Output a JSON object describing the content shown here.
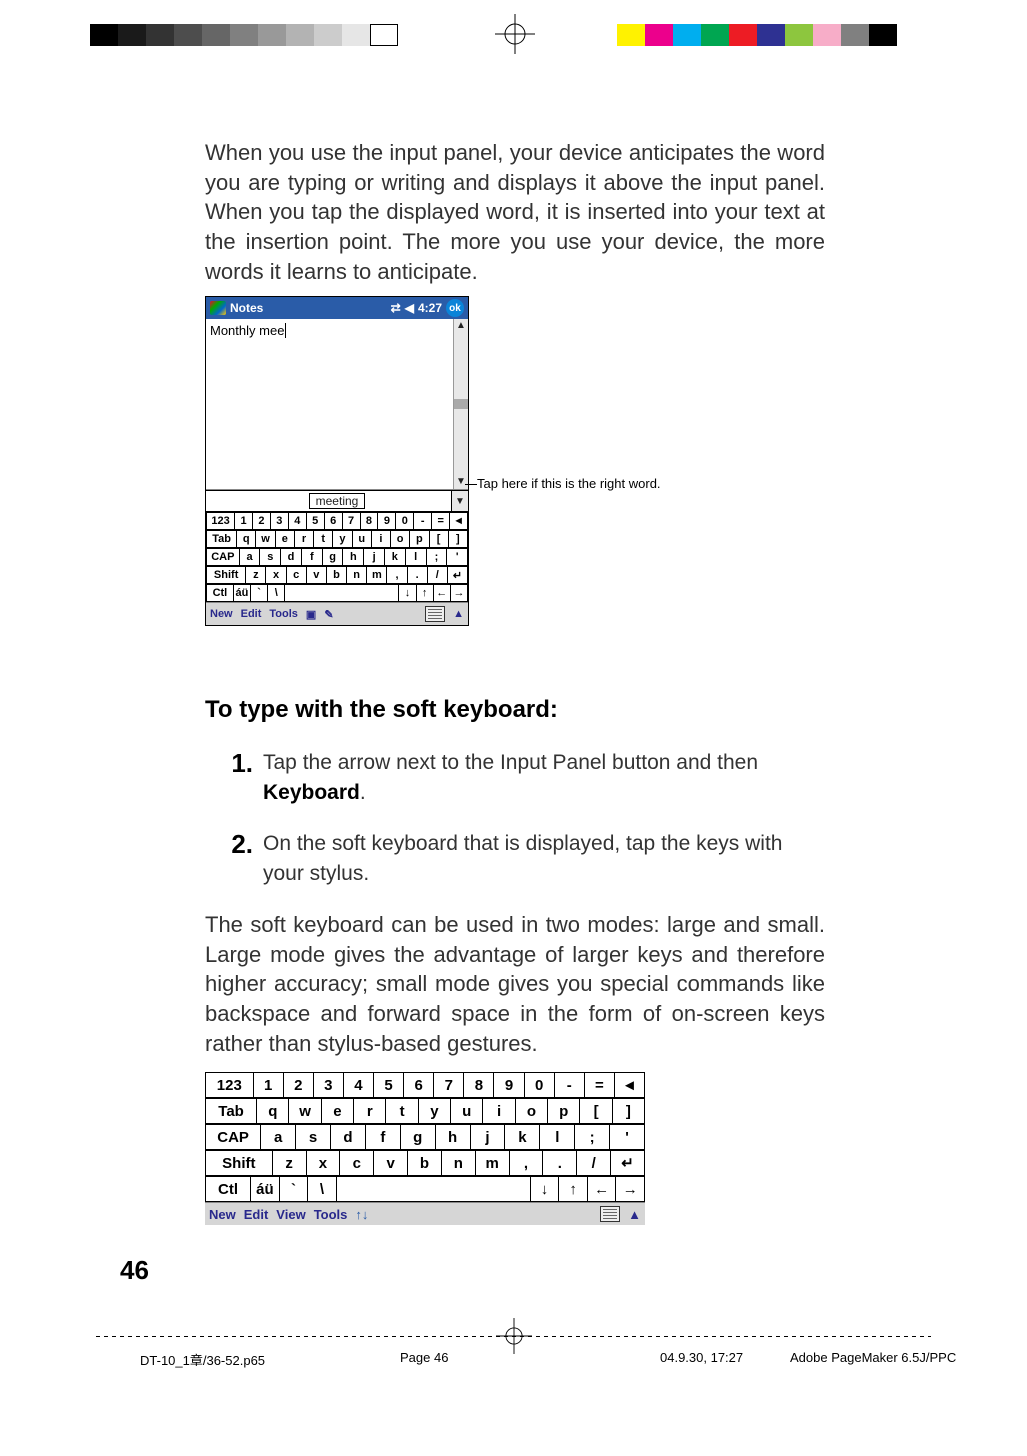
{
  "intro_para": "When you use the input panel, your device anticipates the word you are typing or writing and displays it above the input panel. When you tap the displayed word, it is inserted into your text at the insertion point. The more you use your device, the more words it learns to anticipate.",
  "pda": {
    "app_title": "Notes",
    "time": "4:27",
    "ok": "ok",
    "typed_text": "Monthly mee",
    "suggestion": "meeting",
    "callout": "Tap here if this is the right word.",
    "menu": {
      "new": "New",
      "edit": "Edit",
      "tools": "Tools"
    }
  },
  "keyboard": {
    "row1": [
      "123",
      "1",
      "2",
      "3",
      "4",
      "5",
      "6",
      "7",
      "8",
      "9",
      "0",
      "-",
      "=",
      "◄"
    ],
    "row2": [
      "Tab",
      "q",
      "w",
      "e",
      "r",
      "t",
      "y",
      "u",
      "i",
      "o",
      "p",
      "[",
      "]"
    ],
    "row3": [
      "CAP",
      "a",
      "s",
      "d",
      "f",
      "g",
      "h",
      "j",
      "k",
      "l",
      ";",
      "'"
    ],
    "row4": [
      "Shift",
      "z",
      "x",
      "c",
      "v",
      "b",
      "n",
      "m",
      ",",
      ".",
      "/",
      "↵"
    ],
    "row5": [
      "Ctl",
      "áü",
      "`",
      "\\",
      " ",
      "↓",
      "↑",
      "←",
      "→"
    ]
  },
  "bigkbd_menu": {
    "new": "New",
    "edit": "Edit",
    "view": "View",
    "tools": "Tools"
  },
  "heading": "To type with the soft keyboard:",
  "steps": [
    {
      "num": "1.",
      "pre": "Tap the arrow next to the Input Panel button and then ",
      "bold": "Keyboard",
      "post": "."
    },
    {
      "num": "2.",
      "pre": "On the soft keyboard that is displayed, tap the keys with your stylus.",
      "bold": "",
      "post": ""
    }
  ],
  "para2": "The soft keyboard can be used in two modes: large and small.  Large mode gives the advantage of larger keys and therefore higher accuracy; small mode gives you special commands like backspace and forward space in the form of on-screen keys rather than stylus-based gestures.",
  "page_number": "46",
  "footer": {
    "file": "DT-10_1章/36-52.p65",
    "page": "Page 46",
    "date": "04.9.30, 17:27",
    "app": "Adobe PageMaker 6.5J/PPC"
  },
  "colors": [
    "#fff200",
    "#ec008c",
    "#00aeef",
    "#00a651",
    "#ed1c24",
    "#2e3192",
    "#8dc63e",
    "#f7adc8",
    "#808080",
    "#000000"
  ]
}
